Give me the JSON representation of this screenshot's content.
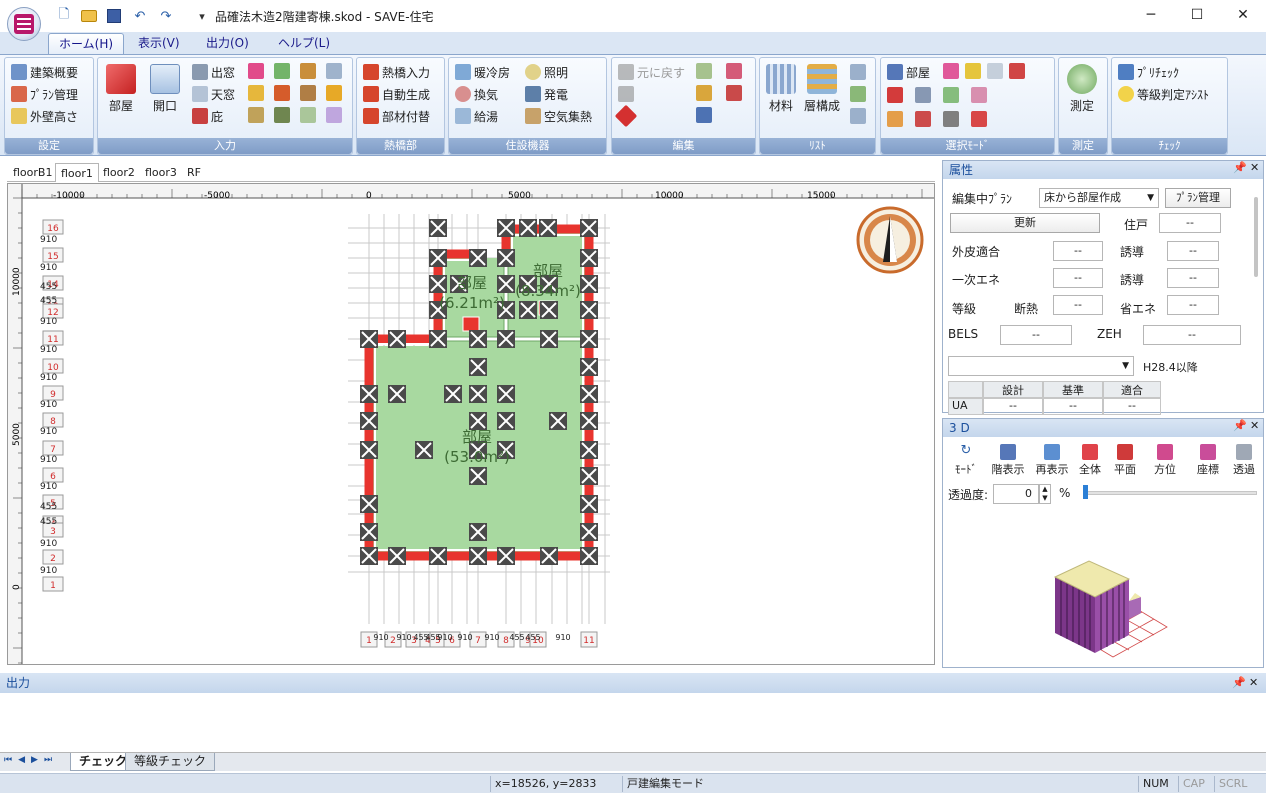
{
  "window": {
    "title": "品確法木造2階建寄棟.skod - SAVE-住宅",
    "minimize": "─",
    "maximize": "☐",
    "close": "✕"
  },
  "quick_access": {
    "icons": [
      "new-file-icon",
      "open-folder-icon",
      "save-icon",
      "undo-icon",
      "redo-icon",
      "customize-dropdown-icon"
    ],
    "customize": "▾"
  },
  "ribbon_tabs": [
    "ホーム(H)",
    "表示(V)",
    "出力(O)",
    "ヘルプ(L)"
  ],
  "ribbon": {
    "settings": {
      "label": "設定",
      "items": [
        "建築概要",
        "ﾌﾟﾗﾝ管理",
        "外壁高さ"
      ]
    },
    "input": {
      "label": "入力",
      "big": [
        "部屋",
        "開口"
      ],
      "items": [
        "出窓",
        "天窓",
        "庇"
      ]
    },
    "thermal_bridge": {
      "label": "熱橋部",
      "items": [
        "熱橋入力",
        "自動生成",
        "部材付替"
      ]
    },
    "equipment": {
      "label": "住設機器",
      "items": [
        "暖冷房",
        "換気",
        "給湯",
        "照明",
        "発電",
        "空気集熱"
      ]
    },
    "edit": {
      "label": "編集",
      "items": [
        "元に戻す"
      ]
    },
    "list": {
      "label": "ﾘｽﾄ",
      "big": [
        "材料",
        "層構成"
      ]
    },
    "select_mode": {
      "label": "選択ﾓｰﾄﾞ",
      "items": [
        "部屋"
      ]
    },
    "measure": {
      "label": "測定",
      "big": [
        "測定"
      ]
    },
    "check": {
      "label": "ﾁｪｯｸ",
      "items": [
        "ﾌﾟﾘﾁｪｯｸ",
        "等級判定ｱｼｽﾄ"
      ]
    }
  },
  "floor_tabs": [
    "floorB1",
    "floor1",
    "floor2",
    "floor3",
    "RF"
  ],
  "active_floor": "floor1",
  "ruler": {
    "top_labels": [
      "-10000",
      "-5000",
      "0",
      "5000",
      "10000",
      "15000"
    ],
    "left_labels": [
      "10000",
      "5000",
      "0"
    ]
  },
  "grid": {
    "row_markers": [
      "16",
      "15",
      "14",
      "13",
      "12",
      "11",
      "10",
      "9",
      "8",
      "7",
      "6",
      "5",
      "4",
      "3",
      "2",
      "1"
    ],
    "row_dims": [
      "910",
      "910",
      "455",
      "455",
      "910",
      "910",
      "910",
      "910",
      "910",
      "910",
      "910",
      "455",
      "455",
      "910",
      "910"
    ],
    "col_markers": [
      "1",
      "2",
      "3",
      "4",
      "5",
      "6",
      "7",
      "8",
      "9",
      "10",
      "11"
    ],
    "col_dims": [
      "910",
      "910",
      "455",
      "455",
      "910",
      "910",
      "910",
      "455",
      "455",
      "910"
    ]
  },
  "rooms": [
    {
      "name": "部屋",
      "area": "(53.0m²)"
    },
    {
      "name": "部屋",
      "area": "(6.21m²)"
    },
    {
      "name": "部屋",
      "area": "(8.34m²)"
    }
  ],
  "attributes": {
    "title": "属性",
    "editing_plan_label": "編集中ﾌﾟﾗﾝ",
    "editing_plan_value": "床から部屋作成",
    "plan_manage_btn": "ﾌﾟﾗﾝ管理",
    "update_btn": "更新",
    "dwelling_label": "住戸",
    "dwelling_value": "--",
    "envelope_label": "外皮適合",
    "envelope_value": "--",
    "induce1_label": "誘導",
    "induce1_value": "--",
    "primary_energy_label": "一次エネ",
    "primary_energy_value": "--",
    "induce2_label": "誘導",
    "induce2_value": "--",
    "grade_label": "等級",
    "insulation_label": "断熱",
    "insulation_value": "--",
    "energy_saving_label": "省エネ",
    "energy_saving_value": "--",
    "bels_label": "BELS",
    "bels_value": "--",
    "zeh_label": "ZEH",
    "zeh_value": "--",
    "standard_select": "",
    "standard_note": "H28.4以降",
    "table_headers": [
      "",
      "設計",
      "基準",
      "適合"
    ],
    "table_row": [
      "UA",
      "--",
      "--",
      "--"
    ]
  },
  "view3d": {
    "title": "3 D",
    "buttons": [
      "ﾓｰﾄﾞ",
      "階表示",
      "再表示",
      "全体",
      "平面",
      "方位",
      "座標",
      "透過"
    ],
    "transparency_label": "透過度:",
    "transparency_value": "0",
    "transparency_unit": "%",
    "transparency_slider": 0
  },
  "output": {
    "title": "出力",
    "tabs": [
      "チェック",
      "等級チェック"
    ],
    "active_tab": "チェック"
  },
  "status": {
    "coords": "x=18526, y=2833",
    "mode": "戸建編集モード",
    "num": "NUM",
    "cap": "CAP",
    "scrl": "SCRL"
  },
  "colors": {
    "accent": "#2a5fa8",
    "room_fill": "#a8d9a0",
    "wall": "#e8342e",
    "column": "#3c3c3c",
    "model_body": "#8a3f96",
    "model_roof": "#efe9ad",
    "compass": "#c96b2c"
  }
}
